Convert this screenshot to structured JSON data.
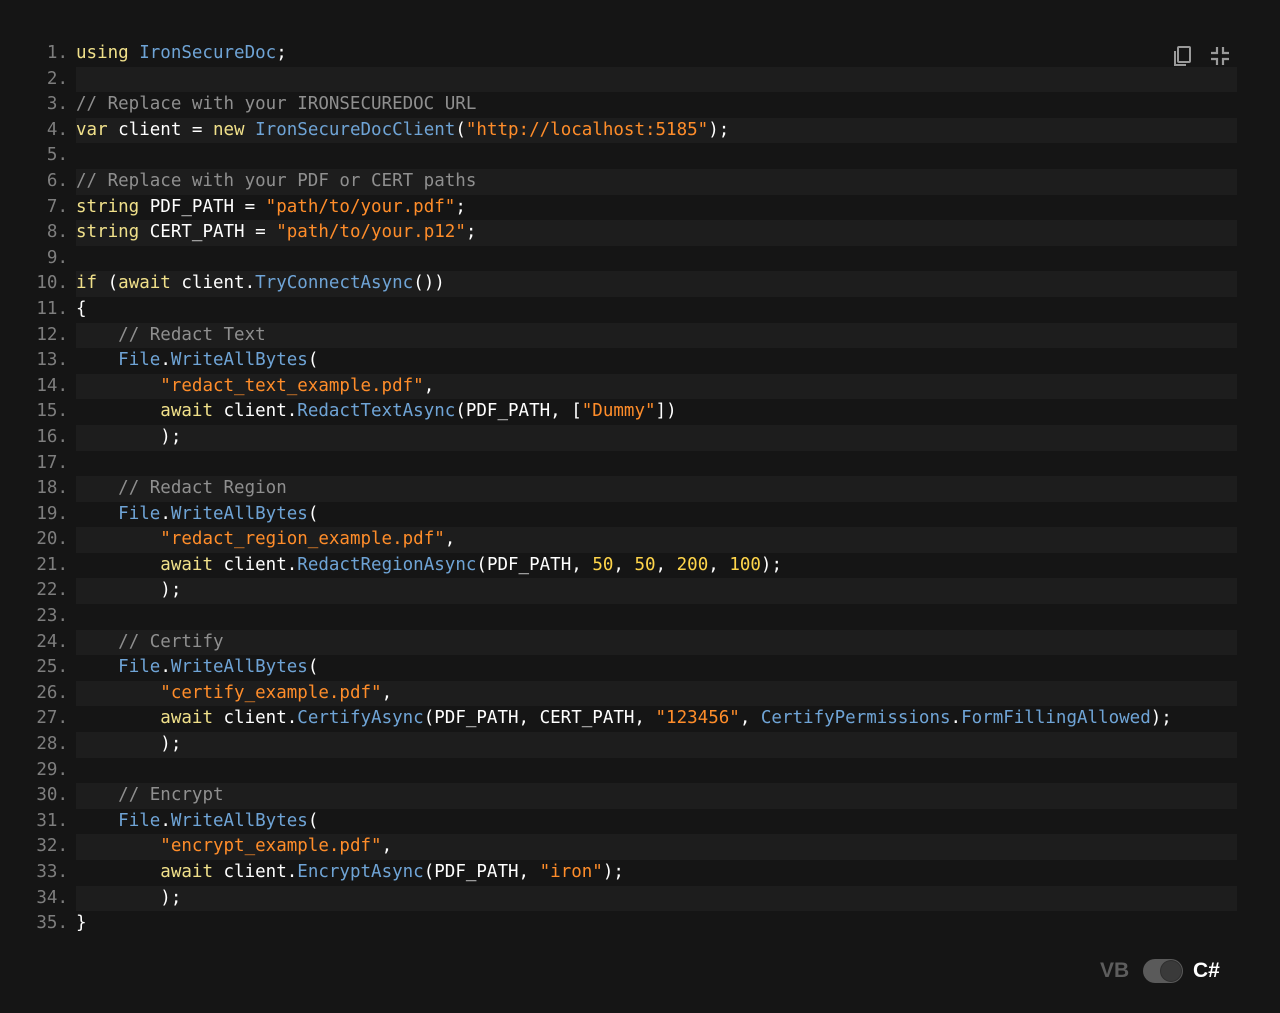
{
  "toolbar": {
    "copy_icon": "copy-icon",
    "collapse_icon": "collapse-icon"
  },
  "language_switch": {
    "left_label": "VB",
    "right_label": "C#",
    "selected": "C#"
  },
  "colors": {
    "background": "#151515",
    "alt_row": "#1d1d1d",
    "keyword": "#f0e08a",
    "type": "#6fa4d6",
    "string": "#ff8d2a",
    "number": "#ffd54a",
    "comment": "#8f8f8f",
    "plain": "#ffffff"
  },
  "code": {
    "lines": [
      {
        "n": "1.",
        "tokens": [
          {
            "t": "kw",
            "v": "using "
          },
          {
            "t": "type",
            "v": "IronSecureDoc"
          },
          {
            "t": "plain",
            "v": ";"
          }
        ]
      },
      {
        "n": "2.",
        "tokens": []
      },
      {
        "n": "3.",
        "tokens": [
          {
            "t": "com",
            "v": "// Replace with your IRONSECUREDOC URL"
          }
        ]
      },
      {
        "n": "4.",
        "tokens": [
          {
            "t": "kw",
            "v": "var "
          },
          {
            "t": "plain",
            "v": "client = "
          },
          {
            "t": "kw",
            "v": "new "
          },
          {
            "t": "type",
            "v": "IronSecureDocClient"
          },
          {
            "t": "plain",
            "v": "("
          },
          {
            "t": "str",
            "v": "\"http://localhost:5185\""
          },
          {
            "t": "plain",
            "v": ");"
          }
        ]
      },
      {
        "n": "5.",
        "tokens": []
      },
      {
        "n": "6.",
        "tokens": [
          {
            "t": "com",
            "v": "// Replace with your PDF or CERT paths"
          }
        ]
      },
      {
        "n": "7.",
        "tokens": [
          {
            "t": "kw",
            "v": "string "
          },
          {
            "t": "plain",
            "v": "PDF_PATH = "
          },
          {
            "t": "str",
            "v": "\"path/to/your.pdf\""
          },
          {
            "t": "plain",
            "v": ";"
          }
        ]
      },
      {
        "n": "8.",
        "tokens": [
          {
            "t": "kw",
            "v": "string "
          },
          {
            "t": "plain",
            "v": "CERT_PATH = "
          },
          {
            "t": "str",
            "v": "\"path/to/your.p12\""
          },
          {
            "t": "plain",
            "v": ";"
          }
        ]
      },
      {
        "n": "9.",
        "tokens": []
      },
      {
        "n": "10.",
        "tokens": [
          {
            "t": "kw",
            "v": "if "
          },
          {
            "t": "plain",
            "v": "("
          },
          {
            "t": "kw",
            "v": "await "
          },
          {
            "t": "plain",
            "v": "client."
          },
          {
            "t": "type",
            "v": "TryConnectAsync"
          },
          {
            "t": "plain",
            "v": "())"
          }
        ]
      },
      {
        "n": "11.",
        "tokens": [
          {
            "t": "plain",
            "v": "{"
          }
        ]
      },
      {
        "n": "12.",
        "tokens": [
          {
            "t": "plain",
            "v": "    "
          },
          {
            "t": "com",
            "v": "// Redact Text"
          }
        ]
      },
      {
        "n": "13.",
        "tokens": [
          {
            "t": "plain",
            "v": "    "
          },
          {
            "t": "type",
            "v": "File"
          },
          {
            "t": "plain",
            "v": "."
          },
          {
            "t": "type",
            "v": "WriteAllBytes"
          },
          {
            "t": "plain",
            "v": "("
          }
        ]
      },
      {
        "n": "14.",
        "tokens": [
          {
            "t": "plain",
            "v": "        "
          },
          {
            "t": "str",
            "v": "\"redact_text_example.pdf\""
          },
          {
            "t": "plain",
            "v": ","
          }
        ]
      },
      {
        "n": "15.",
        "tokens": [
          {
            "t": "plain",
            "v": "        "
          },
          {
            "t": "kw",
            "v": "await "
          },
          {
            "t": "plain",
            "v": "client."
          },
          {
            "t": "type",
            "v": "RedactTextAsync"
          },
          {
            "t": "plain",
            "v": "(PDF_PATH, ["
          },
          {
            "t": "str",
            "v": "\"Dummy\""
          },
          {
            "t": "plain",
            "v": "])"
          }
        ]
      },
      {
        "n": "16.",
        "tokens": [
          {
            "t": "plain",
            "v": "        );"
          }
        ]
      },
      {
        "n": "17.",
        "tokens": []
      },
      {
        "n": "18.",
        "tokens": [
          {
            "t": "plain",
            "v": "    "
          },
          {
            "t": "com",
            "v": "// Redact Region"
          }
        ]
      },
      {
        "n": "19.",
        "tokens": [
          {
            "t": "plain",
            "v": "    "
          },
          {
            "t": "type",
            "v": "File"
          },
          {
            "t": "plain",
            "v": "."
          },
          {
            "t": "type",
            "v": "WriteAllBytes"
          },
          {
            "t": "plain",
            "v": "("
          }
        ]
      },
      {
        "n": "20.",
        "tokens": [
          {
            "t": "plain",
            "v": "        "
          },
          {
            "t": "str",
            "v": "\"redact_region_example.pdf\""
          },
          {
            "t": "plain",
            "v": ","
          }
        ]
      },
      {
        "n": "21.",
        "tokens": [
          {
            "t": "plain",
            "v": "        "
          },
          {
            "t": "kw",
            "v": "await "
          },
          {
            "t": "plain",
            "v": "client."
          },
          {
            "t": "type",
            "v": "RedactRegionAsync"
          },
          {
            "t": "plain",
            "v": "(PDF_PATH, "
          },
          {
            "t": "num",
            "v": "50"
          },
          {
            "t": "plain",
            "v": ", "
          },
          {
            "t": "num",
            "v": "50"
          },
          {
            "t": "plain",
            "v": ", "
          },
          {
            "t": "num",
            "v": "200"
          },
          {
            "t": "plain",
            "v": ", "
          },
          {
            "t": "num",
            "v": "100"
          },
          {
            "t": "plain",
            "v": ");"
          }
        ]
      },
      {
        "n": "22.",
        "tokens": [
          {
            "t": "plain",
            "v": "        );"
          }
        ]
      },
      {
        "n": "23.",
        "tokens": []
      },
      {
        "n": "24.",
        "tokens": [
          {
            "t": "plain",
            "v": "    "
          },
          {
            "t": "com",
            "v": "// Certify"
          }
        ]
      },
      {
        "n": "25.",
        "tokens": [
          {
            "t": "plain",
            "v": "    "
          },
          {
            "t": "type",
            "v": "File"
          },
          {
            "t": "plain",
            "v": "."
          },
          {
            "t": "type",
            "v": "WriteAllBytes"
          },
          {
            "t": "plain",
            "v": "("
          }
        ]
      },
      {
        "n": "26.",
        "tokens": [
          {
            "t": "plain",
            "v": "        "
          },
          {
            "t": "str",
            "v": "\"certify_example.pdf\""
          },
          {
            "t": "plain",
            "v": ","
          }
        ]
      },
      {
        "n": "27.",
        "tokens": [
          {
            "t": "plain",
            "v": "        "
          },
          {
            "t": "kw",
            "v": "await "
          },
          {
            "t": "plain",
            "v": "client."
          },
          {
            "t": "type",
            "v": "CertifyAsync"
          },
          {
            "t": "plain",
            "v": "(PDF_PATH, CERT_PATH, "
          },
          {
            "t": "str",
            "v": "\"123456\""
          },
          {
            "t": "plain",
            "v": ", "
          },
          {
            "t": "type",
            "v": "CertifyPermissions"
          },
          {
            "t": "plain",
            "v": "."
          },
          {
            "t": "type",
            "v": "FormFillingAllowed"
          },
          {
            "t": "plain",
            "v": ");"
          }
        ]
      },
      {
        "n": "28.",
        "tokens": [
          {
            "t": "plain",
            "v": "        );"
          }
        ]
      },
      {
        "n": "29.",
        "tokens": []
      },
      {
        "n": "30.",
        "tokens": [
          {
            "t": "plain",
            "v": "    "
          },
          {
            "t": "com",
            "v": "// Encrypt"
          }
        ]
      },
      {
        "n": "31.",
        "tokens": [
          {
            "t": "plain",
            "v": "    "
          },
          {
            "t": "type",
            "v": "File"
          },
          {
            "t": "plain",
            "v": "."
          },
          {
            "t": "type",
            "v": "WriteAllBytes"
          },
          {
            "t": "plain",
            "v": "("
          }
        ]
      },
      {
        "n": "32.",
        "tokens": [
          {
            "t": "plain",
            "v": "        "
          },
          {
            "t": "str",
            "v": "\"encrypt_example.pdf\""
          },
          {
            "t": "plain",
            "v": ","
          }
        ]
      },
      {
        "n": "33.",
        "tokens": [
          {
            "t": "plain",
            "v": "        "
          },
          {
            "t": "kw",
            "v": "await "
          },
          {
            "t": "plain",
            "v": "client."
          },
          {
            "t": "type",
            "v": "EncryptAsync"
          },
          {
            "t": "plain",
            "v": "(PDF_PATH, "
          },
          {
            "t": "str",
            "v": "\"iron\""
          },
          {
            "t": "plain",
            "v": ");"
          }
        ]
      },
      {
        "n": "34.",
        "tokens": [
          {
            "t": "plain",
            "v": "        );"
          }
        ]
      },
      {
        "n": "35.",
        "tokens": [
          {
            "t": "plain",
            "v": "}"
          }
        ]
      }
    ]
  }
}
